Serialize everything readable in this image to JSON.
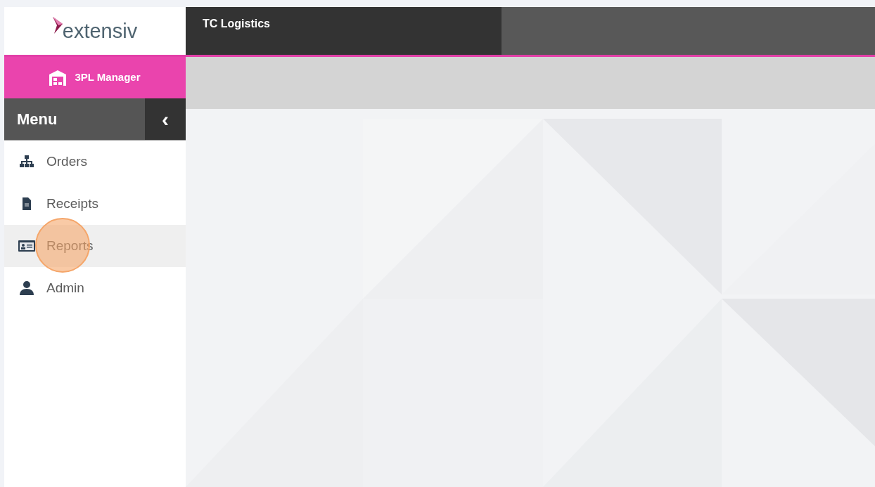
{
  "logo": {
    "text": "extensiv"
  },
  "header": {
    "company": "TC Logistics"
  },
  "product": {
    "label": "3PL Manager"
  },
  "menu": {
    "title": "Menu",
    "collapse_glyph": "‹"
  },
  "sidebar": {
    "items": [
      {
        "label": "Orders",
        "selected": false,
        "clicked": false
      },
      {
        "label": "Receipts",
        "selected": false,
        "clicked": false
      },
      {
        "label": "Reports",
        "selected": true,
        "clicked": true
      },
      {
        "label": "Admin",
        "selected": false,
        "clicked": false
      }
    ]
  }
}
